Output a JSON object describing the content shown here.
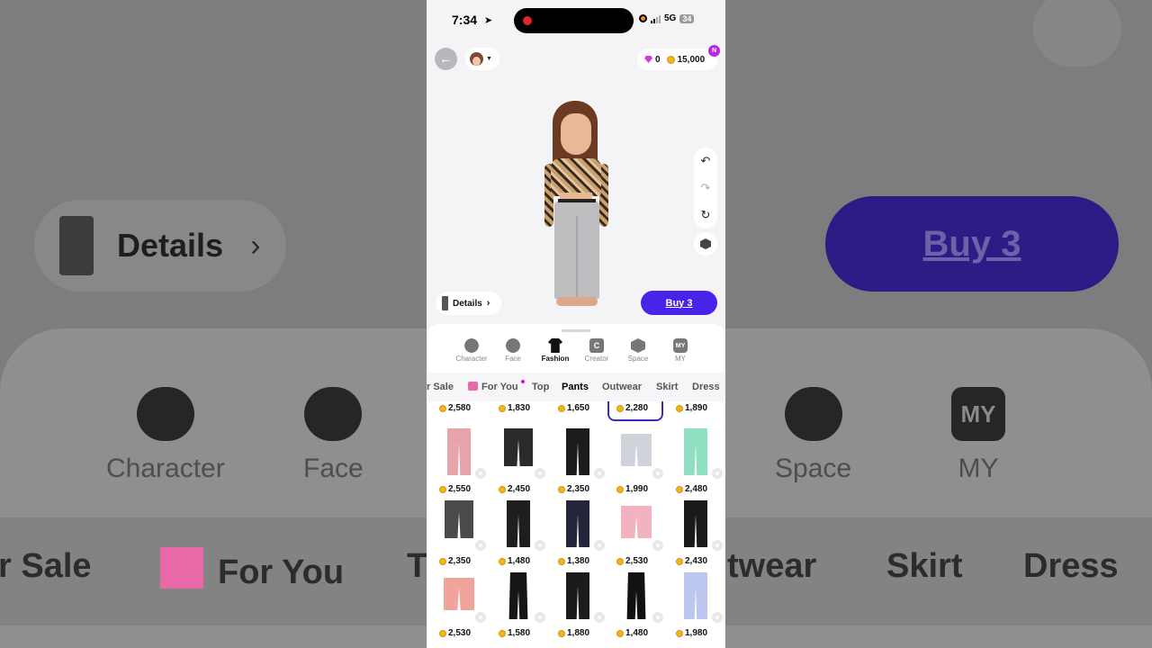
{
  "status_bar": {
    "time": "7:34",
    "network": "5G",
    "battery": "34"
  },
  "header": {
    "gems": "0",
    "coins": "15,000",
    "badge": "N"
  },
  "actions": {
    "details_label": "Details",
    "buy_label": "Buy 3"
  },
  "categories": [
    {
      "label": "Character",
      "icon": "character-icon"
    },
    {
      "label": "Face",
      "icon": "face-icon"
    },
    {
      "label": "Fashion",
      "icon": "shirt-icon",
      "active": true
    },
    {
      "label": "Creator",
      "icon": "creator-icon",
      "glyph": "C"
    },
    {
      "label": "Space",
      "icon": "cube-icon"
    },
    {
      "label": "MY",
      "icon": "my-icon",
      "glyph": "MY"
    }
  ],
  "subtabs": [
    {
      "label": "r Sale"
    },
    {
      "label": "For You"
    },
    {
      "label": "Top"
    },
    {
      "label": "Pants",
      "active": true
    },
    {
      "label": "Outwear"
    },
    {
      "label": "Skirt"
    },
    {
      "label": "Dress"
    }
  ],
  "top_prices": [
    "2,580",
    "1,830",
    "1,650",
    "2,280",
    "1,890"
  ],
  "items": [
    {
      "price": "2,550",
      "color": "#e9a3ab",
      "shape": "long"
    },
    {
      "price": "2,450",
      "color": "#2a2a2a",
      "shape": "short"
    },
    {
      "price": "2,350",
      "color": "#1c1c1c",
      "shape": "long"
    },
    {
      "price": "1,990",
      "color": "#cfd3da",
      "shape": "shorts"
    },
    {
      "price": "2,480",
      "color": "#8fe0c0",
      "shape": "long"
    },
    {
      "price": "2,350",
      "color": "#4a4a4a",
      "shape": "short"
    },
    {
      "price": "1,480",
      "color": "#1e1e1e",
      "shape": "long"
    },
    {
      "price": "1,380",
      "color": "#23263a",
      "shape": "long"
    },
    {
      "price": "2,530",
      "color": "#f2b2bf",
      "shape": "shorts"
    },
    {
      "price": "2,430",
      "color": "#1a1a1a",
      "shape": "long"
    },
    {
      "price": "2,530",
      "color": "#f0a49b",
      "shape": "shorts"
    },
    {
      "price": "1,580",
      "color": "#161616",
      "shape": "flare"
    },
    {
      "price": "1,880",
      "color": "#1b1b1b",
      "shape": "long"
    },
    {
      "price": "1,480",
      "color": "#111111",
      "shape": "flare"
    },
    {
      "price": "1,980",
      "color": "#bcc6ee",
      "shape": "long"
    }
  ],
  "background": {
    "details_label": "Details",
    "buy_label": "Buy 3",
    "left_categories": [
      "Character",
      "Face"
    ],
    "right_categories": [
      "Space",
      "MY"
    ],
    "left_subtabs": [
      "r Sale",
      "For You",
      "T"
    ],
    "right_subtabs": [
      "twear",
      "Skirt",
      "Dress"
    ]
  }
}
